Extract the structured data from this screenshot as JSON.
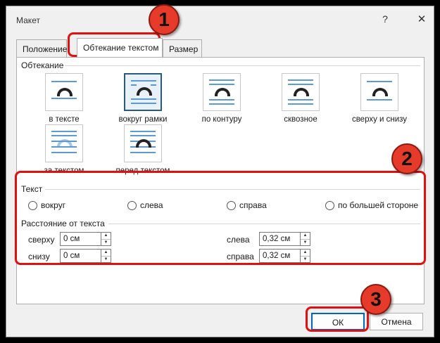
{
  "window": {
    "title": "Макет",
    "help": "?",
    "close": "✕"
  },
  "tabs": [
    {
      "label": "Положение"
    },
    {
      "label": "Обтекание текстом"
    },
    {
      "label": "Размер"
    }
  ],
  "wrapping": {
    "heading": "Обтекание",
    "styles": [
      {
        "label": "в тексте",
        "selected": false
      },
      {
        "label": "вокруг рамки",
        "selected": true
      },
      {
        "label": "по контуру",
        "selected": false
      },
      {
        "label": "сквозное",
        "selected": false
      },
      {
        "label": "сверху и снизу",
        "selected": false
      },
      {
        "label": "за текстом",
        "selected": false
      },
      {
        "label": "перед текстом",
        "selected": false
      }
    ]
  },
  "text_side": {
    "heading": "Текст",
    "options": [
      {
        "label": "вокруг",
        "checked": false
      },
      {
        "label": "слева",
        "checked": false
      },
      {
        "label": "справа",
        "checked": false
      },
      {
        "label": "по большей стороне",
        "checked": false
      }
    ]
  },
  "distance": {
    "heading": "Расстояние от текста",
    "top": {
      "label": "сверху",
      "value": "0 см"
    },
    "bottom": {
      "label": "снизу",
      "value": "0 см"
    },
    "left": {
      "label": "слева",
      "value": "0,32 см"
    },
    "right": {
      "label": "справа",
      "value": "0,32 см"
    }
  },
  "buttons": {
    "ok": "ОК",
    "cancel": "Отмена"
  },
  "annotations": {
    "badge1": "1",
    "badge2": "2",
    "badge3": "3",
    "color": "#e01010"
  }
}
